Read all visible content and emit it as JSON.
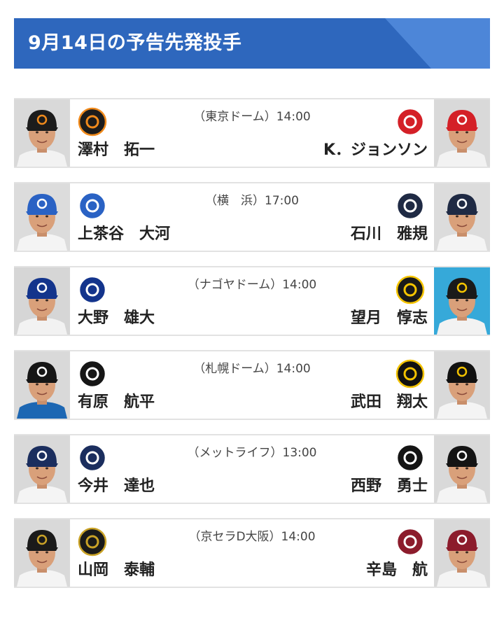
{
  "header": {
    "title": "9月14日の予告先発投手"
  },
  "colors": {
    "header_bg": "#2e67bd",
    "header_accent": "#4d86d8",
    "card_border": "#e2e2e2"
  },
  "games": [
    {
      "venue_time": "（東京ドーム）14:00",
      "home": {
        "pitcher": "澤村　拓一",
        "team_logo": "giants-logo",
        "photo": "pitcher-photo",
        "cap_color": "#1c1c1c",
        "brim_color": "#1c1c1c",
        "emblem_color": "#f08a1c",
        "bg_color": "#d9d9d9",
        "uniform_color": "#f2f2f2"
      },
      "away": {
        "pitcher": "K．ジョンソン",
        "team_logo": "carp-logo",
        "photo": "pitcher-photo",
        "cap_color": "#d42027",
        "brim_color": "#d42027",
        "emblem_color": "#ffffff",
        "bg_color": "#d9d9d9",
        "uniform_color": "#f2f2f2"
      }
    },
    {
      "venue_time": "（横　浜）17:00",
      "home": {
        "pitcher": "上茶谷　大河",
        "team_logo": "baystars-logo",
        "photo": "pitcher-photo",
        "cap_color": "#2a62c4",
        "brim_color": "#2a62c4",
        "emblem_color": "#ffffff",
        "bg_color": "#dcdcdc",
        "uniform_color": "#f4f4f4"
      },
      "away": {
        "pitcher": "石川　雅規",
        "team_logo": "swallows-logo",
        "photo": "pitcher-photo",
        "cap_color": "#1f2a44",
        "brim_color": "#1f2a44",
        "emblem_color": "#ffffff",
        "bg_color": "#dcdcdc",
        "uniform_color": "#f4f4f4"
      }
    },
    {
      "venue_time": "（ナゴヤドーム）14:00",
      "home": {
        "pitcher": "大野　雄大",
        "team_logo": "dragons-logo",
        "photo": "pitcher-photo",
        "cap_color": "#13348c",
        "brim_color": "#13348c",
        "emblem_color": "#ffffff",
        "bg_color": "#d6d6d6",
        "uniform_color": "#f2f2f2"
      },
      "away": {
        "pitcher": "望月　惇志",
        "team_logo": "tigers-logo",
        "photo": "pitcher-photo",
        "cap_color": "#1a1a1a",
        "brim_color": "#1a1a1a",
        "emblem_color": "#f6c500",
        "bg_color": "#36a9d9",
        "uniform_color": "#f2f2f2"
      }
    },
    {
      "venue_time": "（札幌ドーム）14:00",
      "home": {
        "pitcher": "有原　航平",
        "team_logo": "fighters-logo",
        "photo": "pitcher-photo",
        "cap_color": "#161616",
        "brim_color": "#161616",
        "emblem_color": "#ffffff",
        "bg_color": "#d9d9d9",
        "uniform_color": "#1d67b3"
      },
      "away": {
        "pitcher": "武田　翔太",
        "team_logo": "hawks-logo",
        "photo": "pitcher-photo",
        "cap_color": "#111111",
        "brim_color": "#111111",
        "emblem_color": "#f2c200",
        "bg_color": "#d9d9d9",
        "uniform_color": "#f4f4f4"
      }
    },
    {
      "venue_time": "（メットライフ）13:00",
      "home": {
        "pitcher": "今井　達也",
        "team_logo": "lions-logo",
        "photo": "pitcher-photo",
        "cap_color": "#1b2e5e",
        "brim_color": "#1b2e5e",
        "emblem_color": "#ffffff",
        "bg_color": "#d9d9d9",
        "uniform_color": "#f4f4f4"
      },
      "away": {
        "pitcher": "西野　勇士",
        "team_logo": "marines-logo",
        "photo": "pitcher-photo",
        "cap_color": "#141414",
        "brim_color": "#141414",
        "emblem_color": "#ffffff",
        "bg_color": "#d9d9d9",
        "uniform_color": "#f4f4f4"
      }
    },
    {
      "venue_time": "（京セラD大阪）14:00",
      "home": {
        "pitcher": "山岡　泰輔",
        "team_logo": "buffaloes-logo",
        "photo": "pitcher-photo",
        "cap_color": "#1a1a1a",
        "brim_color": "#1a1a1a",
        "emblem_color": "#c9a227",
        "bg_color": "#d9d9d9",
        "uniform_color": "#f4f4f4"
      },
      "away": {
        "pitcher": "辛島　航",
        "team_logo": "eagles-logo",
        "photo": "pitcher-photo",
        "cap_color": "#8c1c2c",
        "brim_color": "#8c1c2c",
        "emblem_color": "#ffffff",
        "bg_color": "#d9d9d9",
        "uniform_color": "#f4f4f4"
      }
    }
  ]
}
